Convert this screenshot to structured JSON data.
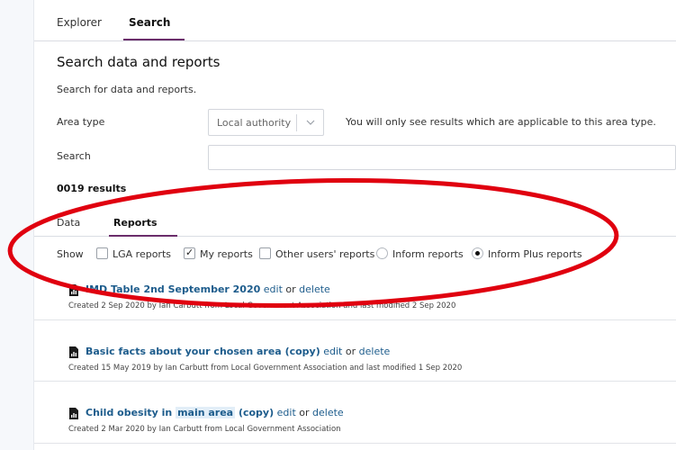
{
  "tabs": {
    "explorer": "Explorer",
    "search": "Search"
  },
  "page": {
    "title": "Search data and reports",
    "subtitle": "Search for data and reports."
  },
  "area_type": {
    "label": "Area type",
    "value": "Local authority",
    "note": "You will only see results which are applicable to this area type."
  },
  "search": {
    "label": "Search",
    "value": ""
  },
  "results": {
    "count": "0019 results"
  },
  "sub_tabs": {
    "data": "Data",
    "reports": "Reports"
  },
  "filters": {
    "show_label": "Show",
    "lga": {
      "label": "LGA reports",
      "checked": false
    },
    "my": {
      "label": "My reports",
      "checked": true
    },
    "other": {
      "label": "Other users' reports",
      "checked": false
    },
    "inform": {
      "label": "Inform reports",
      "selected": false
    },
    "inform_plus": {
      "label": "Inform Plus reports",
      "selected": true
    }
  },
  "reports": [
    {
      "title": "IMD Table 2nd September 2020",
      "edit": "edit",
      "or": "or",
      "delete": "delete",
      "meta": "Created 2 Sep 2020 by Ian Carbutt from Local Government Association and last modified 2 Sep 2020"
    },
    {
      "title": "Basic facts about your chosen area (copy)",
      "edit": "edit",
      "or": "or",
      "delete": "delete",
      "meta": "Created 15 May 2019 by Ian Carbutt from Local Government Association and last modified 1 Sep 2020"
    },
    {
      "title_before": "Child obesity in",
      "title_highlight": "main area",
      "title_after": "(copy)",
      "edit": "edit",
      "or": "or",
      "delete": "delete",
      "meta": "Created 2 Mar 2020 by Ian Carbutt from Local Government Association"
    }
  ],
  "colors": {
    "accent": "#6b2d6b",
    "link": "#1d5c8c",
    "annotation": "#e0000f"
  }
}
